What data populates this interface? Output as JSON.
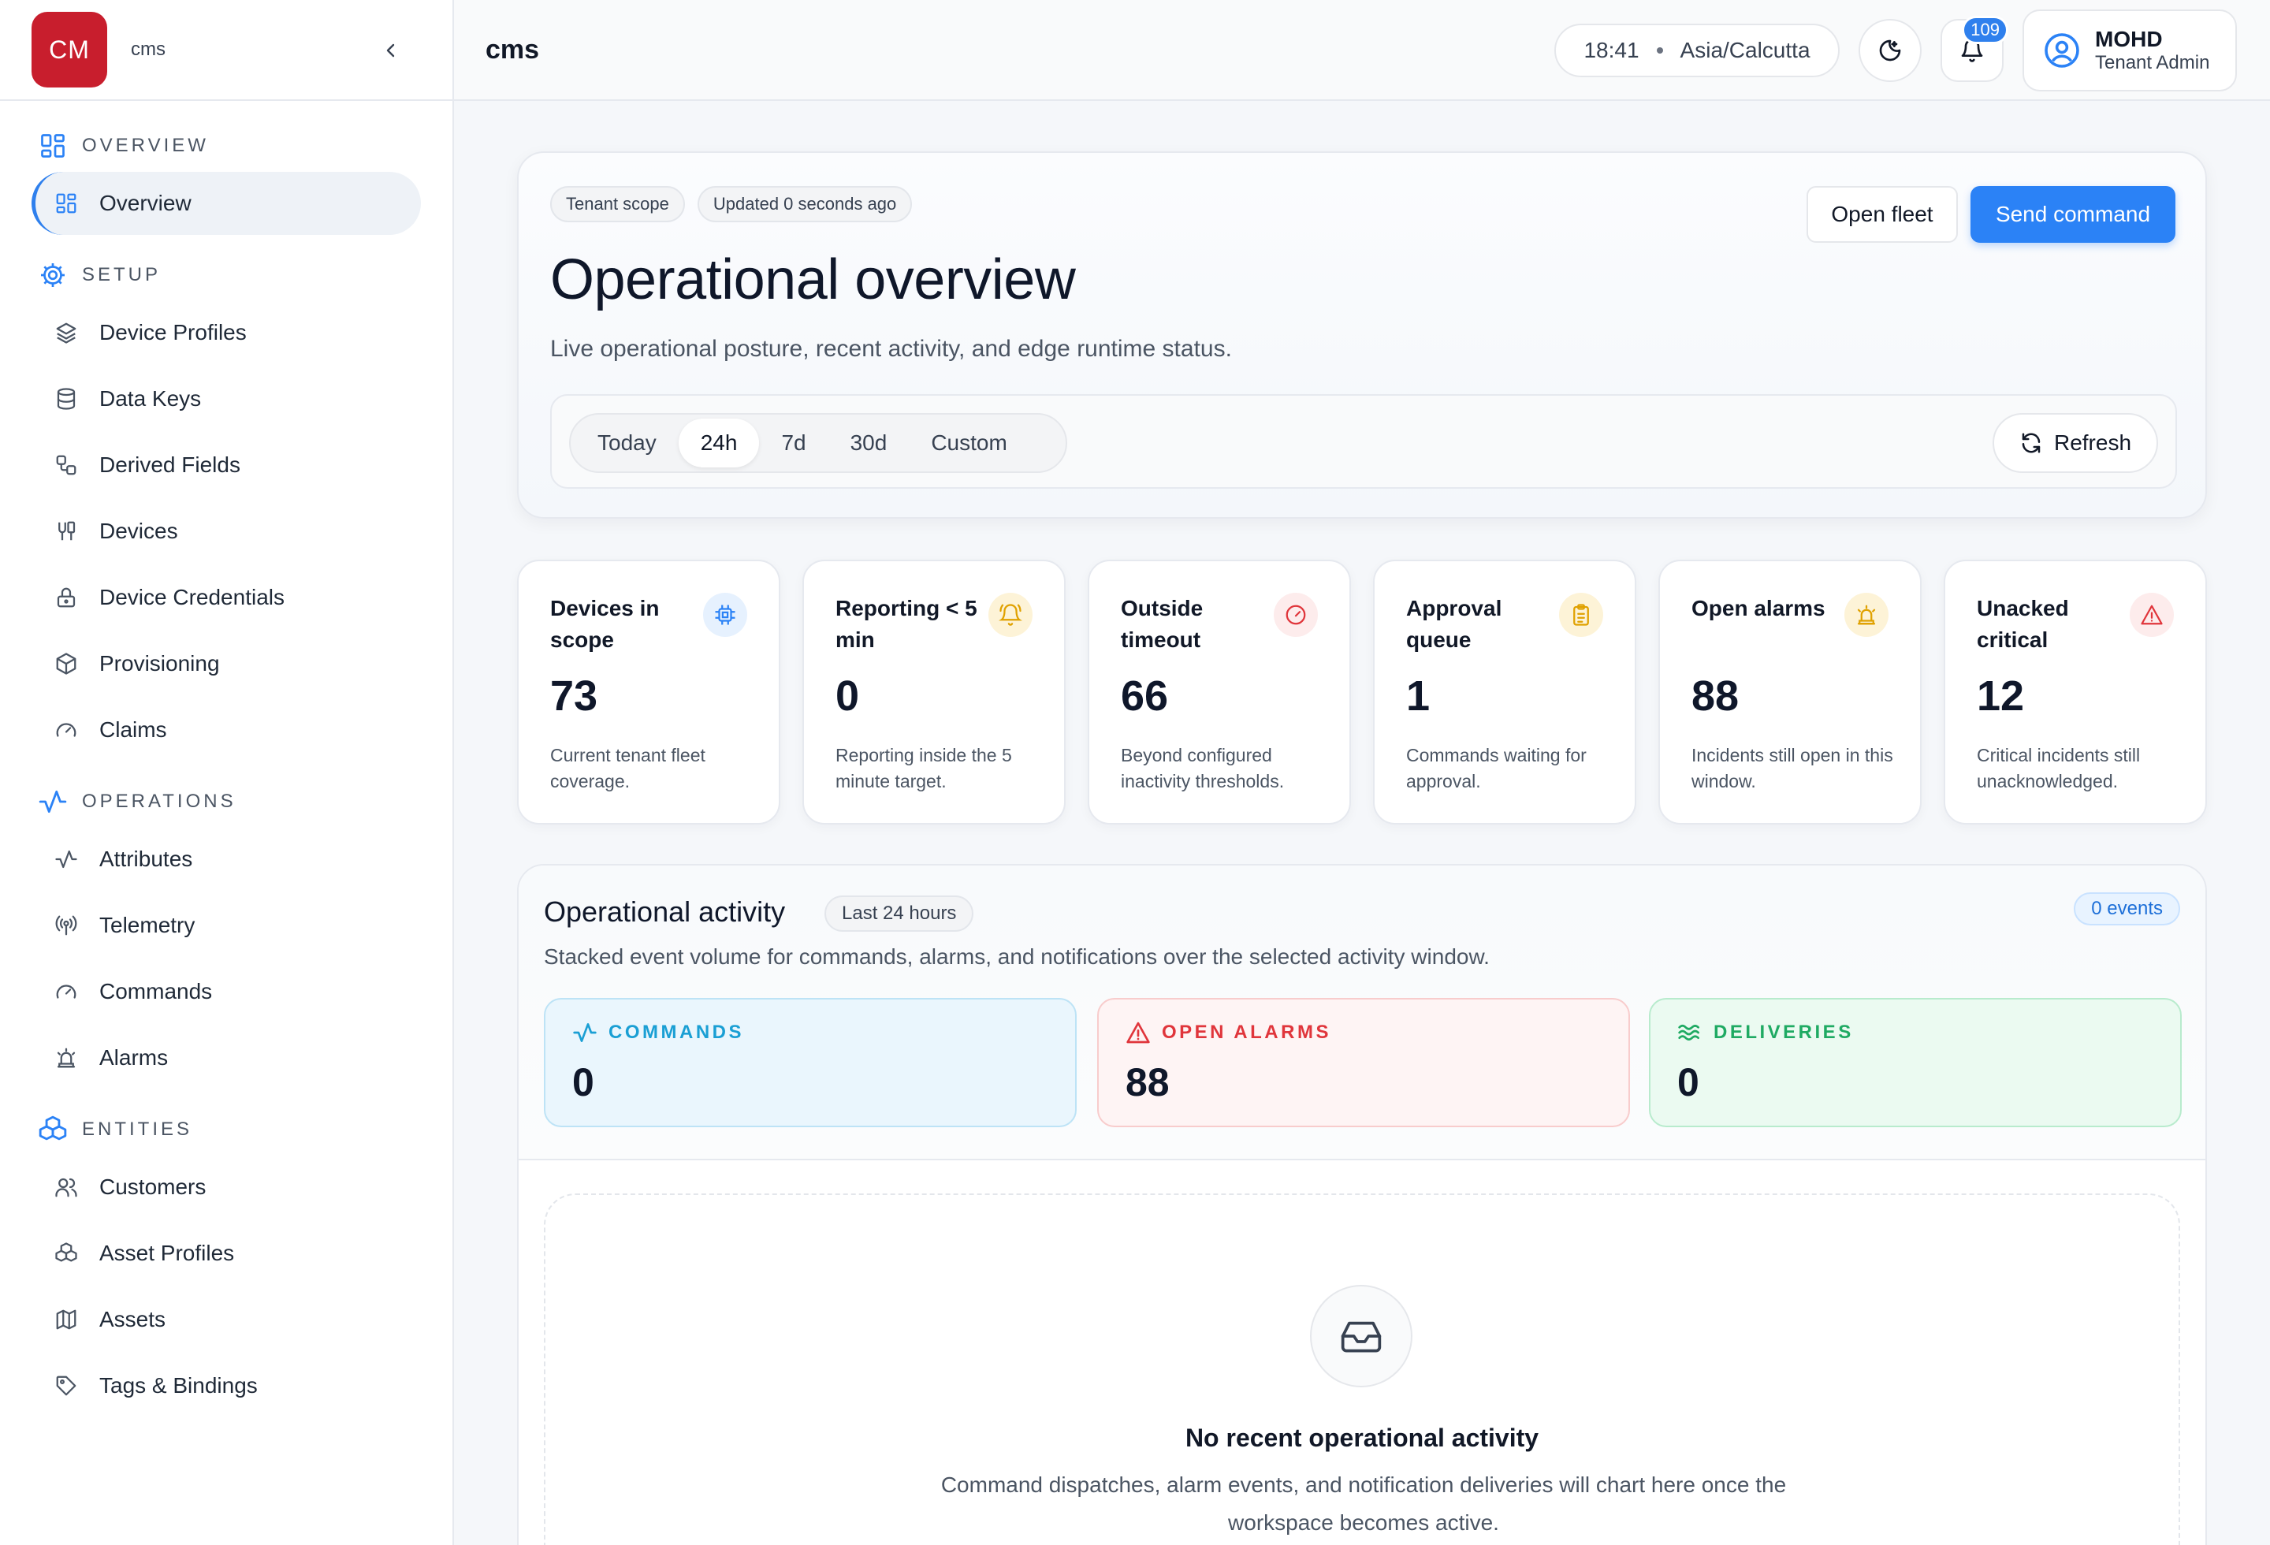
{
  "brand": {
    "logo_text": "CM",
    "name": "cms"
  },
  "sidebar": {
    "sections": [
      {
        "title": "OVERVIEW",
        "icon": "grid-icon",
        "items": [
          {
            "label": "Overview",
            "icon": "grid-icon",
            "active": true
          }
        ]
      },
      {
        "title": "SETUP",
        "icon": "gear-icon",
        "items": [
          {
            "label": "Device Profiles",
            "icon": "layers-icon"
          },
          {
            "label": "Data Keys",
            "icon": "database-icon"
          },
          {
            "label": "Derived Fields",
            "icon": "workflow-icon"
          },
          {
            "label": "Devices",
            "icon": "devices-icon"
          },
          {
            "label": "Device Credentials",
            "icon": "lock-icon"
          },
          {
            "label": "Provisioning",
            "icon": "box-icon"
          },
          {
            "label": "Claims",
            "icon": "gauge-icon"
          }
        ]
      },
      {
        "title": "OPERATIONS",
        "icon": "activity-icon",
        "items": [
          {
            "label": "Attributes",
            "icon": "activity-icon"
          },
          {
            "label": "Telemetry",
            "icon": "radio-icon"
          },
          {
            "label": "Commands",
            "icon": "gauge-icon"
          },
          {
            "label": "Alarms",
            "icon": "siren-icon"
          }
        ]
      },
      {
        "title": "ENTITIES",
        "icon": "boxes-icon",
        "items": [
          {
            "label": "Customers",
            "icon": "users-icon"
          },
          {
            "label": "Asset Profiles",
            "icon": "boxes-icon"
          },
          {
            "label": "Assets",
            "icon": "map-icon"
          },
          {
            "label": "Tags & Bindings",
            "icon": "tag-icon"
          }
        ]
      }
    ]
  },
  "topbar": {
    "title": "cms",
    "time": "18:41",
    "timezone": "Asia/Calcutta",
    "notification_count": "109",
    "user_name": "MOHD",
    "user_role": "Tenant Admin"
  },
  "hero": {
    "chip_scope": "Tenant scope",
    "chip_updated": "Updated 0 seconds ago",
    "title": "Operational overview",
    "subtitle": "Live operational posture, recent activity, and edge runtime status.",
    "open_fleet_label": "Open fleet",
    "send_command_label": "Send command",
    "ranges": [
      "Today",
      "24h",
      "7d",
      "30d",
      "Custom"
    ],
    "selected_range": "24h",
    "refresh_label": "Refresh"
  },
  "stats": [
    {
      "label": "Devices in scope",
      "value": "73",
      "desc": "Current tenant fleet coverage.",
      "icon": "cpu-icon",
      "color": "#2b82f6",
      "bg": "#e6f1fe"
    },
    {
      "label": "Reporting < 5 min",
      "value": "0",
      "desc": "Reporting inside the 5 minute target.",
      "icon": "bell-ring-icon",
      "color": "#e0a100",
      "bg": "#fdf3d7"
    },
    {
      "label": "Outside timeout",
      "value": "66",
      "desc": "Beyond configured inactivity thresholds.",
      "icon": "gauge-icon",
      "color": "#e0353b",
      "bg": "#fdecec"
    },
    {
      "label": "Approval queue",
      "value": "1",
      "desc": "Commands waiting for approval.",
      "icon": "clipboard-icon",
      "color": "#e0a100",
      "bg": "#fdf3d7"
    },
    {
      "label": "Open alarms",
      "value": "88",
      "desc": "Incidents still open in this window.",
      "icon": "siren-icon",
      "color": "#e0a100",
      "bg": "#fdf3d7"
    },
    {
      "label": "Unacked critical",
      "value": "12",
      "desc": "Critical incidents still unacknowledged.",
      "icon": "alert-triangle-icon",
      "color": "#e0353b",
      "bg": "#fdecec"
    }
  ],
  "activity": {
    "title": "Operational activity",
    "chip": "Last 24 hours",
    "events": "0 events",
    "subtitle": "Stacked event volume for commands, alarms, and notifications over the selected activity window.",
    "metrics": [
      {
        "label": "COMMANDS",
        "value": "0",
        "icon": "activity-icon"
      },
      {
        "label": "OPEN ALARMS",
        "value": "88",
        "icon": "alert-triangle-icon"
      },
      {
        "label": "DELIVERIES",
        "value": "0",
        "icon": "waves-icon"
      }
    ],
    "empty_title": "No recent operational activity",
    "empty_desc": "Command dispatches, alarm events, and notification deliveries will chart here once the workspace becomes active."
  },
  "colors": {
    "accent": "#2b82f6",
    "brand": "#c81e2d"
  }
}
